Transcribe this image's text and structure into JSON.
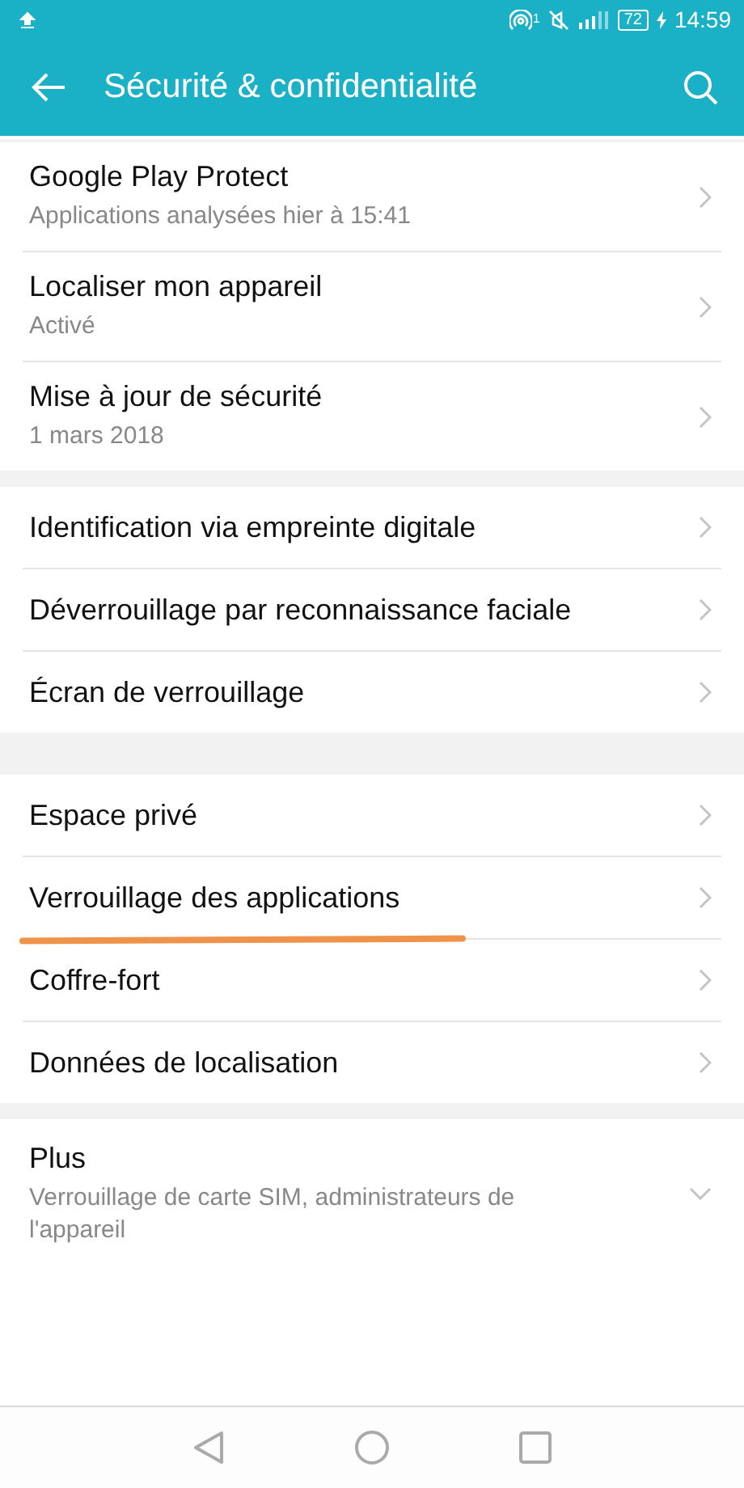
{
  "status_bar": {
    "hotspot_count": "1",
    "battery": "72",
    "time": "14:59"
  },
  "toolbar": {
    "title": "Sécurité & confidentialité"
  },
  "groups": [
    {
      "items": [
        {
          "kind": "link",
          "title": "Google Play Protect",
          "subtitle": "Applications analysées hier à 15:41",
          "underlined": false
        },
        {
          "kind": "link",
          "title": "Localiser mon appareil",
          "subtitle": "Activé",
          "underlined": false
        },
        {
          "kind": "link",
          "title": "Mise à jour de sécurité",
          "subtitle": "1 mars 2018",
          "underlined": false
        }
      ]
    },
    {
      "items": [
        {
          "kind": "link",
          "title": "Identification via empreinte digitale",
          "underlined": false
        },
        {
          "kind": "link",
          "title": "Déverrouillage par reconnaissance faciale",
          "underlined": false
        },
        {
          "kind": "link",
          "title": "Écran de verrouillage",
          "underlined": false
        }
      ]
    },
    {
      "items": [
        {
          "kind": "link",
          "title": "Espace privé",
          "underlined": false
        },
        {
          "kind": "link",
          "title": "Verrouillage des applications",
          "underlined": true
        },
        {
          "kind": "link",
          "title": "Coffre-fort",
          "underlined": false
        },
        {
          "kind": "link",
          "title": "Données de localisation",
          "underlined": false
        }
      ]
    },
    {
      "items": [
        {
          "kind": "expand",
          "title": "Plus",
          "subtitle": "Verrouillage de carte SIM, administrateurs de l'appareil",
          "expanded": false,
          "underlined": false
        }
      ]
    }
  ]
}
